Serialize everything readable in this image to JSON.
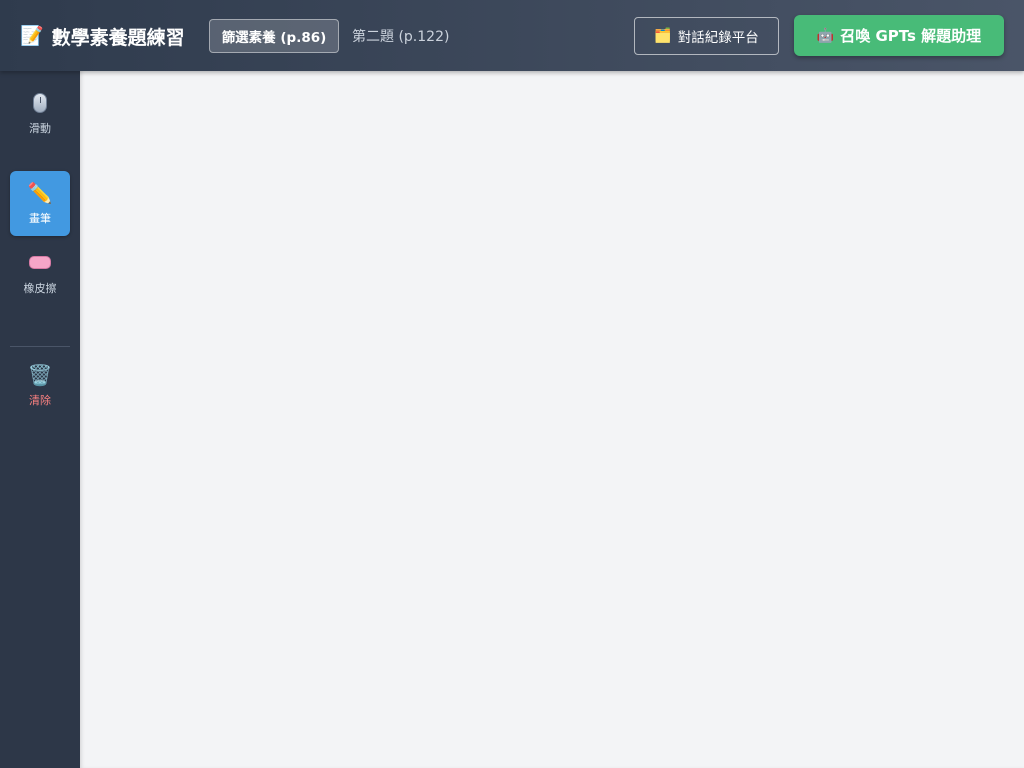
{
  "header": {
    "title": "數學素養題練習",
    "title_icon": "📝",
    "tabs": [
      {
        "label": "篩選素養 (p.86)",
        "active": true
      },
      {
        "label": "第二題 (p.122)",
        "active": false
      }
    ],
    "history_button": {
      "icon": "🗂️",
      "label": "對話紀錄平台"
    },
    "gpts_button": {
      "icon": "🤖",
      "label": "召喚 GPTs 解題助理"
    }
  },
  "sidebar": {
    "tools": [
      {
        "icon": "mouse-icon",
        "label": "滑動",
        "active": false
      },
      {
        "icon": "pencil-icon",
        "label": "畫筆",
        "active": true
      },
      {
        "icon": "eraser-icon",
        "label": "橡皮擦",
        "active": false
      }
    ],
    "clear": {
      "icon": "🗑️",
      "label": "清除"
    }
  },
  "colors": {
    "header_start": "#2f3b4d",
    "header_end": "#4a5568",
    "sidebar": "#2d3748",
    "active_tool": "#4299e1",
    "primary_button": "#48bb78",
    "clear_label": "#fc8181",
    "canvas": "#f3f4f6"
  }
}
